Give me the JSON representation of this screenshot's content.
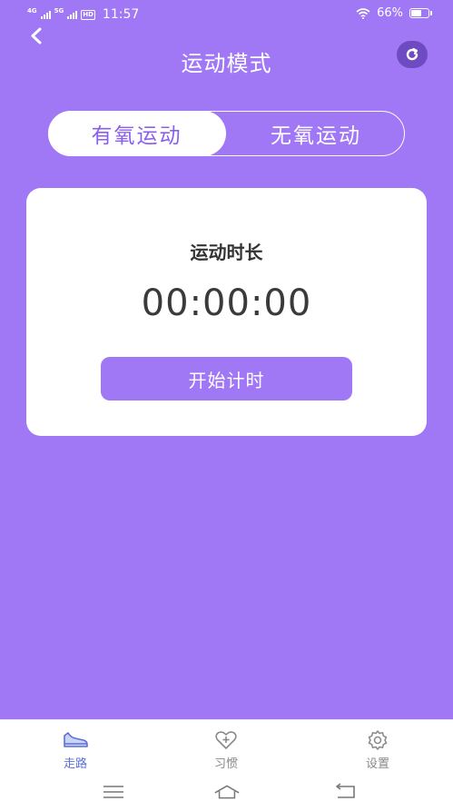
{
  "status_bar": {
    "net1": "4G",
    "net2": "5G",
    "hd": "HD",
    "time": "11:57",
    "battery_text": "66%",
    "battery_level": 0.66
  },
  "header": {
    "title": "运动模式",
    "back_icon": "chevron-left-icon",
    "refresh_icon": "refresh-icon"
  },
  "segment": {
    "tabs": [
      {
        "label": "有氧运动",
        "active": true
      },
      {
        "label": "无氧运动",
        "active": false
      }
    ]
  },
  "card": {
    "label": "运动时长",
    "timer": "00:00:00",
    "start_button": "开始计时"
  },
  "bottom_nav": {
    "items": [
      {
        "label": "走路",
        "icon": "shoe-icon",
        "active": true
      },
      {
        "label": "习惯",
        "icon": "heart-plus-icon",
        "active": false
      },
      {
        "label": "设置",
        "icon": "gear-icon",
        "active": false
      }
    ]
  },
  "colors": {
    "primary": "#a077f5",
    "active_nav": "#5b6fd8",
    "refresh_bg": "#6f4bc2"
  }
}
